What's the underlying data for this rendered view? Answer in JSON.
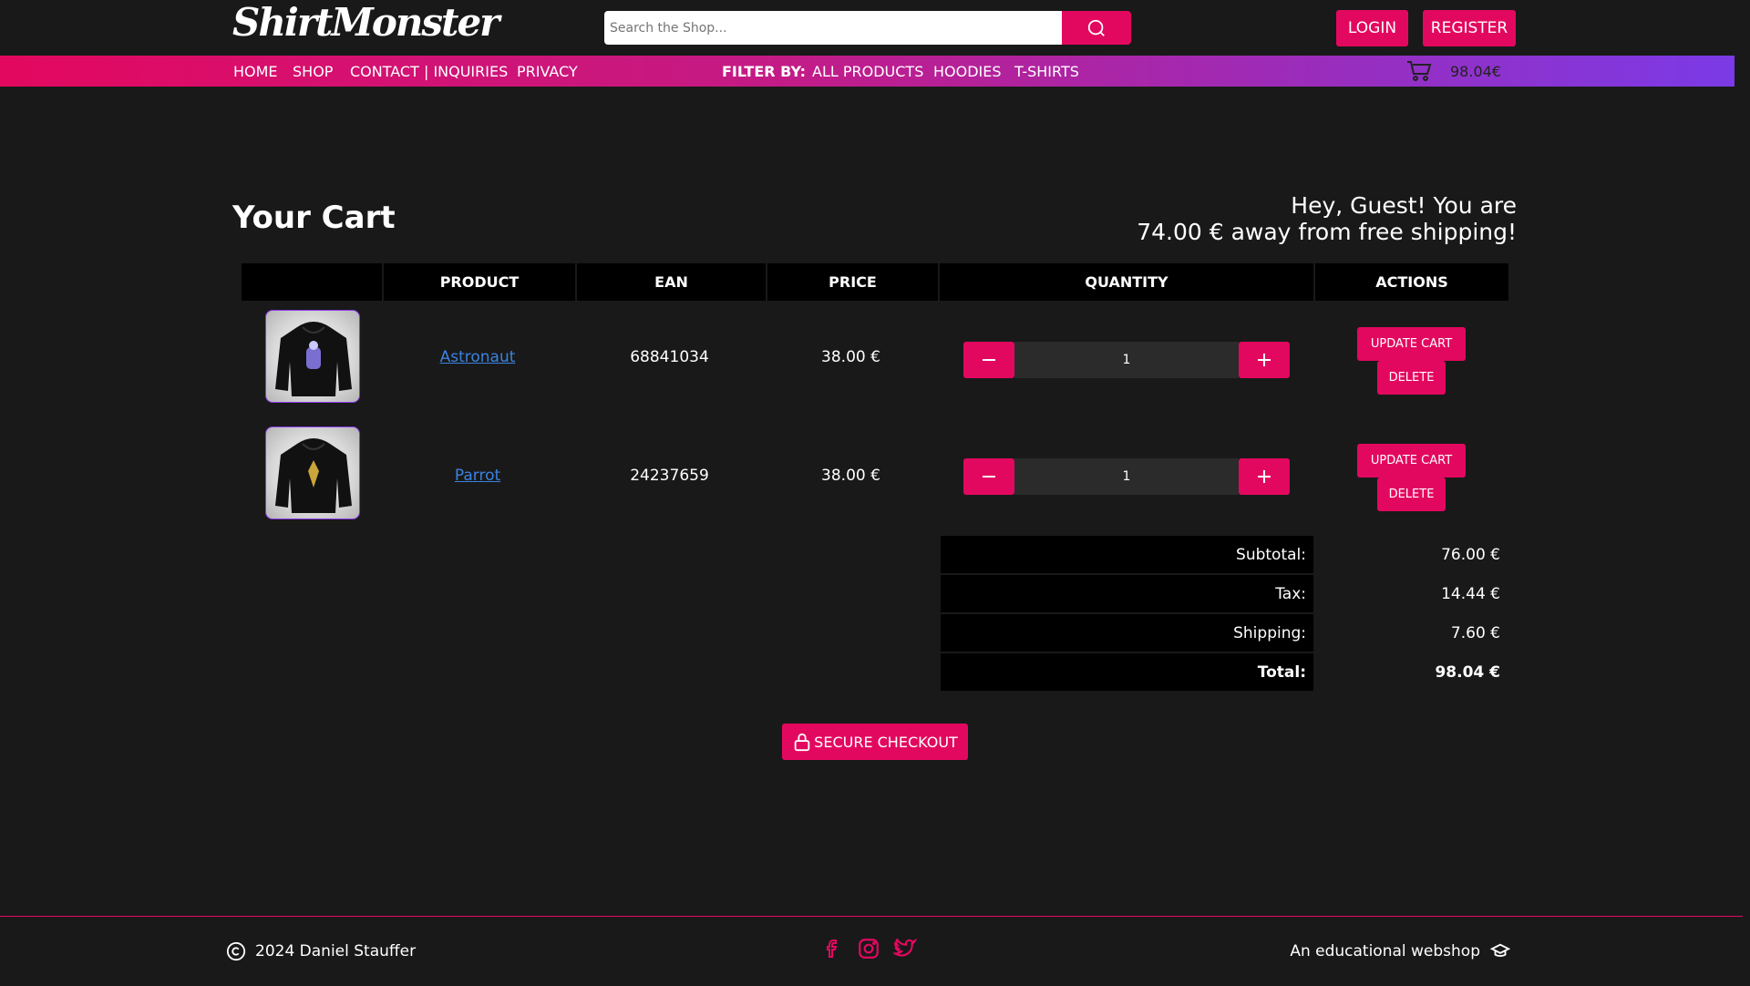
{
  "header": {
    "logo_text": "ShirtMonster",
    "search_placeholder": "Search the Shop...",
    "login_label": "LOGIN",
    "register_label": "REGISTER"
  },
  "nav": {
    "items": [
      "HOME",
      "SHOP",
      "CONTACT | INQUIRIES",
      "PRIVACY"
    ],
    "filter_label": "FILTER BY:",
    "filters": [
      "ALL PRODUCTS",
      "HOODIES",
      "T-SHIRTS"
    ],
    "cart_total": "98.04€"
  },
  "main": {
    "title": "Your Cart",
    "shipping_line1": "Hey, Guest! You are",
    "shipping_line2": "74.00 € away from free shipping!"
  },
  "table": {
    "headers": [
      "",
      "PRODUCT",
      "EAN",
      "PRICE",
      "QUANTITY",
      "ACTIONS"
    ],
    "rows": [
      {
        "product": "Astronaut",
        "ean": "68841034",
        "price": "38.00 €",
        "quantity": "1",
        "image_icon": "hoodie-image",
        "print_color": "#7a6fd0"
      },
      {
        "product": "Parrot",
        "ean": "24237659",
        "price": "38.00 €",
        "quantity": "1",
        "image_icon": "hoodie-image",
        "print_color": "#c9a53a"
      }
    ],
    "update_label": "UPDATE CART",
    "delete_label": "DELETE"
  },
  "totals": {
    "subtotal_label": "Subtotal:",
    "subtotal": "76.00 €",
    "tax_label": "Tax:",
    "tax": "14.44 €",
    "shipping_label": "Shipping:",
    "shipping": "7.60 €",
    "total_label": "Total:",
    "total": "98.04 €"
  },
  "checkout_label": "SECURE CHECKOUT",
  "footer": {
    "copyright": "2024 Daniel Stauffer",
    "tagline": "An educational webshop",
    "social_icons": [
      "facebook-icon",
      "instagram-icon",
      "twitter-icon"
    ]
  },
  "colors": {
    "accent": "#e3085f",
    "purple": "#7b3ae6",
    "background": "#191919",
    "link": "#3a83e0"
  }
}
